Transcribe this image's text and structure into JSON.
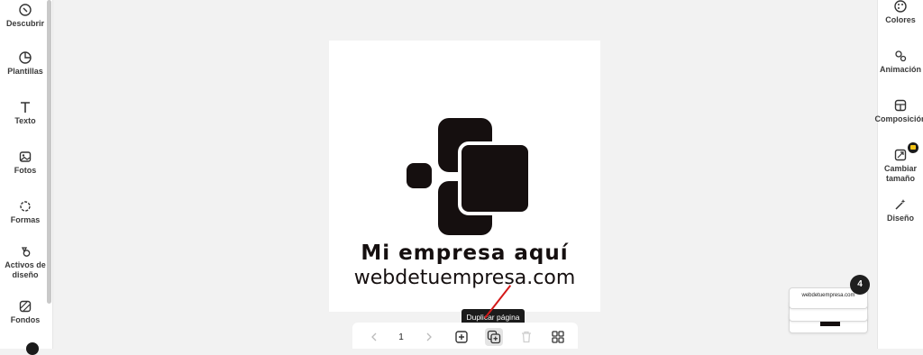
{
  "left_sidebar": {
    "items": [
      {
        "label": "Descubrir",
        "icon": "compass-icon"
      },
      {
        "label": "Plantillas",
        "icon": "template-icon"
      },
      {
        "label": "Texto",
        "icon": "text-icon"
      },
      {
        "label": "Fotos",
        "icon": "image-icon"
      },
      {
        "label": "Formas",
        "icon": "shapes-icon"
      },
      {
        "label": "Activos de diseño",
        "icon": "assets-icon"
      },
      {
        "label": "Fondos",
        "icon": "background-icon"
      }
    ]
  },
  "right_sidebar": {
    "items": [
      {
        "label": "Colores",
        "icon": "palette-icon"
      },
      {
        "label": "Animación",
        "icon": "animation-icon"
      },
      {
        "label": "Composición",
        "icon": "layout-icon"
      },
      {
        "label": "Cambiar tamaño",
        "icon": "resize-icon"
      },
      {
        "label": "Diseño",
        "icon": "magic-wand-icon"
      }
    ]
  },
  "canvas": {
    "company_name": "Mi empresa aquí",
    "company_url": "webdetuempresa.com"
  },
  "toolbar": {
    "page_number": "1",
    "tooltip": "Duplicar página"
  },
  "pages": {
    "count": "4",
    "thumb_text": "webdetuempresa.com"
  },
  "colors": {
    "logo": "#150f0f",
    "annotation_arrow": "#d41919",
    "premium_badge": "#f5c518"
  }
}
